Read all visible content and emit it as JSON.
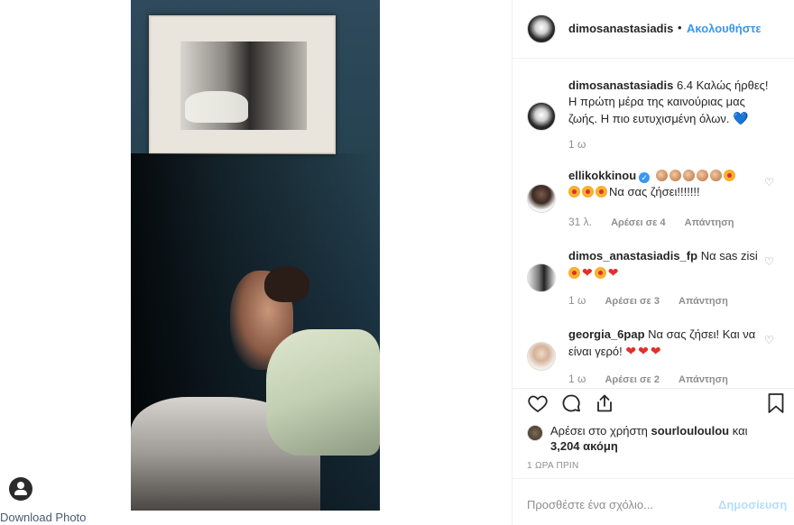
{
  "download": {
    "label": "Download Photo",
    "icon": "user-circle-icon"
  },
  "post": {
    "username": "dimosanastasiadis",
    "separator": "•",
    "follow_label": "Ακολουθήστε"
  },
  "caption": {
    "username": "dimosanastasiadis",
    "text": " 6.4 Καλώς ήρθες! Η πρώτη μέρα της καινούριας μας ζωής. Η πιο ευτυχισμένη όλων.",
    "emoji": "💙",
    "time": "1 ω"
  },
  "comments": [
    {
      "username": "ellikokkinou",
      "verified": true,
      "text": "Να σας ζήσει!!!!!!!",
      "time": "31 λ.",
      "likes": "Αρέσει σε 4",
      "reply": "Απάντηση"
    },
    {
      "username": "dimos_anastasiadis_fp",
      "text": "Να sas zisi",
      "time": "1 ω",
      "likes": "Αρέσει σε 3",
      "reply": "Απάντηση"
    },
    {
      "username": "georgia_6pap",
      "text": "Να σας ζήσει! Και να είναι γερό!",
      "time": "1 ω",
      "likes": "Αρέσει σε 2",
      "reply": "Απάντηση"
    }
  ],
  "likes": {
    "prefix": "Αρέσει στο χρήστη",
    "user": "sourlouloulou",
    "connector": "και",
    "count": "3,204 ακόμη"
  },
  "timestamp": "1 ΩΡΑ ΠΡΙΝ",
  "add_comment": {
    "placeholder": "Προσθέστε ένα σχόλιο...",
    "post_label": "Δημοσίευση"
  },
  "icons": {
    "like": "heart-icon",
    "comment": "comment-icon",
    "share": "share-icon",
    "save": "bookmark-icon"
  }
}
